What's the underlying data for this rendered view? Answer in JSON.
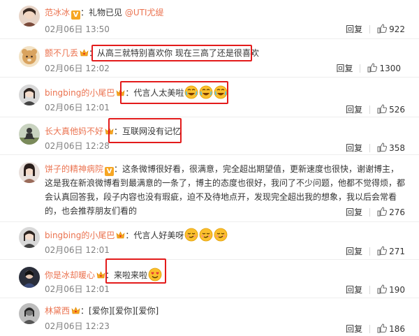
{
  "colors": {
    "username": "#eb7350",
    "highlight": "#e31b1b",
    "time": "#808080"
  },
  "reply_label": "回复",
  "comments": [
    {
      "user": "范冰冰",
      "badge": "V",
      "text": "礼物已见 ",
      "mention": "@UTI尤缇",
      "time": "02月06日 13:50",
      "likes": "922"
    },
    {
      "user": "颤不几丢",
      "badge": "crown",
      "text": "从高三就特别喜欢你 现在三高了还是很喜欢",
      "time": "02月06日 12:02",
      "likes": "1300"
    },
    {
      "user": "bingbing的小尾巴",
      "badge": "crown",
      "text": "代言人太美啦",
      "emoji": [
        "crying-laugh-emoji",
        "crying-laugh-emoji",
        "crying-laugh-emoji"
      ],
      "time": "02月06日 12:01",
      "likes": "526"
    },
    {
      "user": "长大真他妈不好",
      "badge": "crown",
      "text": "互联网没有记忆",
      "time": "02月06日 12:28",
      "likes": "358"
    },
    {
      "user": "饼子的精神病院",
      "badge": "V",
      "text": "这条微博很好看，很满意，完全超出期望值，更新速度也很快，谢谢博主，这是我在新浪微博看到最满意的一条了，博主的态度也很好，我问了不少问题，他都不觉得烦，都会认真回答我，段子内容也没有瑕疵，迫不及待地点开，发现完全超出我的想象，我以后会常看的，也会推荐朋友们看的",
      "time": "",
      "likes": "276"
    },
    {
      "user": "bingbing的小尾巴",
      "badge": "crown",
      "text": "代言人好美呀",
      "emoji": [
        "smirk-emoji",
        "smirk-emoji",
        "smirk-emoji"
      ],
      "time": "02月06日 12:01",
      "likes": "271"
    },
    {
      "user": "你是冰却暖心",
      "badge": "crown",
      "text": "来啦来啦",
      "emoji": [
        "heart-eyes-emoji"
      ],
      "time": "02月06日 12:01",
      "likes": "190"
    },
    {
      "user": "林黛西",
      "badge": "crown",
      "text": "[爱你][爱你][爱你]",
      "time": "02月06日 12:23",
      "likes": "186"
    }
  ]
}
